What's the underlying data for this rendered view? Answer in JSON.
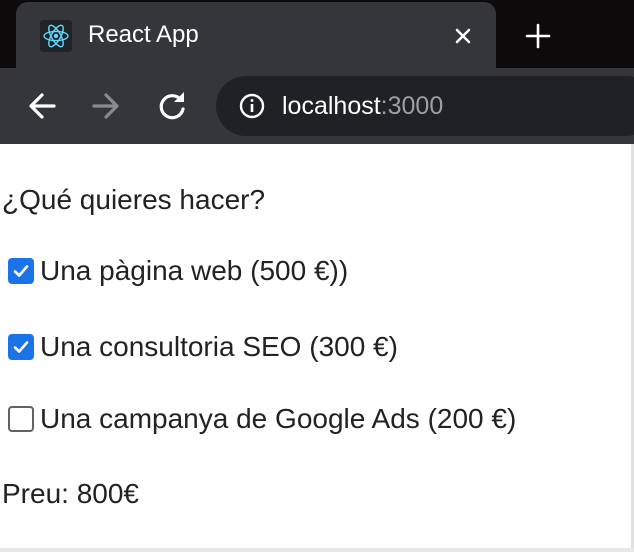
{
  "browser": {
    "tab_title": "React App",
    "url_host": "localhost",
    "url_port": ":3000",
    "icons": {
      "favicon": "react-logo-icon",
      "tab_close": "close-icon",
      "new_tab": "plus-icon",
      "back": "arrow-left-icon",
      "forward": "arrow-right-icon",
      "reload": "reload-icon",
      "site_info": "info-icon"
    },
    "colors": {
      "tabstrip": "#0d0a0b",
      "tab": "#35363a",
      "omnibox": "#202124",
      "react": "#61dafb"
    }
  },
  "page": {
    "question": "¿Qué quieres hacer?",
    "options": [
      {
        "label": "Una pàgina web (500 €))",
        "checked": true
      },
      {
        "label": "Una consultoria SEO (300 €)",
        "checked": true
      },
      {
        "label": "Una campanya de Google Ads (200 €)",
        "checked": false
      }
    ],
    "total": "Preu: 800€",
    "colors": {
      "checkbox_checked": "#1a73e8",
      "text": "#222222"
    }
  }
}
